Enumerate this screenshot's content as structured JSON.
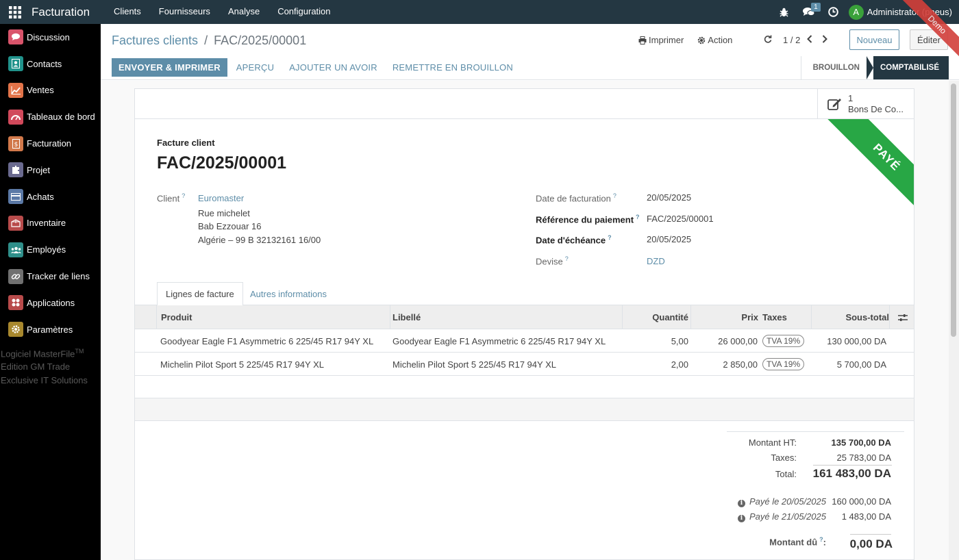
{
  "navbar": {
    "brand": "Facturation",
    "menu": [
      "Clients",
      "Fournisseurs",
      "Analyse",
      "Configuration"
    ],
    "messages_badge": "1",
    "user_initial": "A",
    "user_name": "Administrator (pneus)",
    "demo_ribbon": "Demo"
  },
  "sidebar": {
    "items": [
      {
        "label": "Discussion",
        "icon": "discussion-icon",
        "color": "#d9546b"
      },
      {
        "label": "Contacts",
        "icon": "contacts-icon",
        "color": "#20928b"
      },
      {
        "label": "Ventes",
        "icon": "sales-icon",
        "color": "#e27349"
      },
      {
        "label": "Tableaux de bord",
        "icon": "dashboard-icon",
        "color": "#d1495b"
      },
      {
        "label": "Facturation",
        "icon": "invoicing-icon",
        "color": "#d1784a"
      },
      {
        "label": "Projet",
        "icon": "project-icon",
        "color": "#6a6a8f"
      },
      {
        "label": "Achats",
        "icon": "purchase-icon",
        "color": "#5b79a6"
      },
      {
        "label": "Inventaire",
        "icon": "inventory-icon",
        "color": "#b84b4b"
      },
      {
        "label": "Employés",
        "icon": "employees-icon",
        "color": "#2f8f8a"
      },
      {
        "label": "Tracker de liens",
        "icon": "link-tracker-icon",
        "color": "#707070"
      },
      {
        "label": "Applications",
        "icon": "apps-icon",
        "color": "#b84b4b"
      },
      {
        "label": "Paramètres",
        "icon": "settings-icon",
        "color": "#a8882e"
      }
    ],
    "footer": {
      "line1": "Logiciel MasterFile",
      "tm": "TM",
      "line2": "Edition GM Trade",
      "line3": "Exclusive IT Solutions"
    }
  },
  "control_panel": {
    "breadcrumb_parent": "Factures clients",
    "breadcrumb_sep": "/",
    "breadcrumb_current": "FAC/2025/00001",
    "print_label": "Imprimer",
    "action_label": "Action",
    "pager_value": "1 / 2",
    "new_label": "Nouveau",
    "edit_label": "Éditer",
    "buttons": {
      "send_print": "ENVOYER & IMPRIMER",
      "preview": "APERÇU",
      "add_credit": "AJOUTER UN AVOIR",
      "reset_draft": "REMETTRE EN BROUILLON"
    },
    "status": {
      "draft": "BROUILLON",
      "posted": "COMPTABILISÉ"
    }
  },
  "sheet": {
    "smart_button": {
      "count": "1",
      "label": "Bons De Co..."
    },
    "paid_ribbon": "PAYÉ",
    "doc_type": "Facture client",
    "doc_name": "FAC/2025/00001",
    "client": {
      "label": "Client",
      "name": "Euromaster",
      "address1": "Rue michelet",
      "address2": "Bab Ezzouar 16",
      "address3": "Algérie – 99 B 32132161 16/00"
    },
    "fields": {
      "invoice_date_label": "Date de facturation",
      "invoice_date": "20/05/2025",
      "payment_ref_label": "Référence du paiement",
      "payment_ref": "FAC/2025/00001",
      "due_date_label": "Date d'échéance",
      "due_date": "20/05/2025",
      "currency_label": "Devise",
      "currency": "DZD"
    },
    "tabs": [
      "Lignes de facture",
      "Autres informations"
    ],
    "table": {
      "headers": {
        "product": "Produit",
        "label": "Libellé",
        "qty": "Quantité",
        "price": "Prix",
        "taxes": "Taxes",
        "subtotal": "Sous-total"
      },
      "rows": [
        {
          "product": "Goodyear Eagle F1 Asymmetric 6 225/45 R17 94Y XL",
          "label": "Goodyear Eagle F1 Asymmetric 6 225/45 R17 94Y XL",
          "qty": "5,00",
          "price": "26 000,00",
          "tax": "TVA 19%",
          "subtotal": "130 000,00 DA"
        },
        {
          "product": "Michelin Pilot Sport 5 225/45 R17 94Y XL",
          "label": "Michelin Pilot Sport 5 225/45 R17 94Y XL",
          "qty": "2,00",
          "price": "2 850,00",
          "tax": "TVA 19%",
          "subtotal": "5 700,00 DA"
        }
      ]
    },
    "totals": {
      "untaxed_label": "Montant HT:",
      "untaxed": "135 700,00 DA",
      "taxes_label": "Taxes:",
      "taxes": "25 783,00 DA",
      "total_label": "Total:",
      "total": "161 483,00 DA",
      "payments": [
        {
          "label": "Payé le 20/05/2025",
          "amount": "160 000,00 DA"
        },
        {
          "label": "Payé le 21/05/2025",
          "amount": "1 483,00 DA"
        }
      ],
      "due_label": "Montant dû",
      "due_colon": ":",
      "due": "0,00 DA"
    }
  }
}
